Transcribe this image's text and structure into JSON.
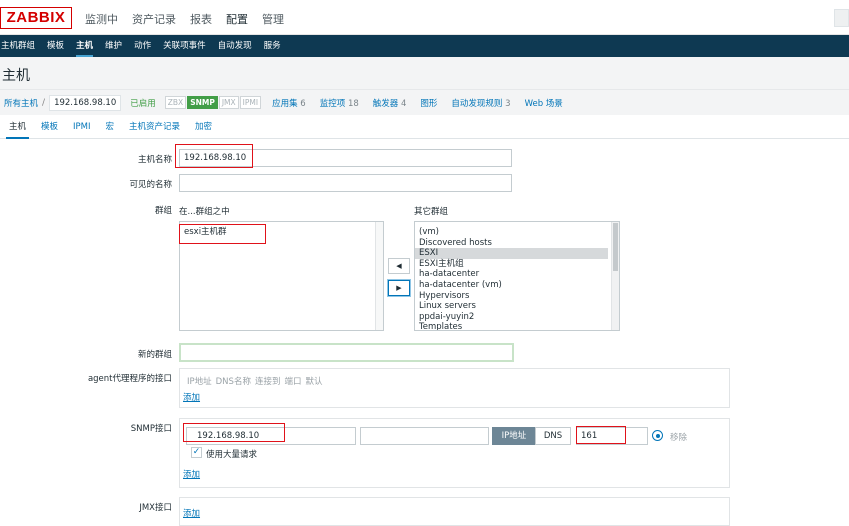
{
  "top": {
    "logo": "ZABBIX",
    "nav": [
      "监测中",
      "资产记录",
      "报表",
      "配置",
      "管理"
    ],
    "active_nav": "配置"
  },
  "subnav": [
    "主机群组",
    "模板",
    "主机",
    "维护",
    "动作",
    "关联项事件",
    "自动发现",
    "服务"
  ],
  "page_title": "主机",
  "breadcrumb": {
    "all_hosts": "所有主机",
    "separator": "/",
    "host": "192.168.98.10",
    "status": "已启用",
    "interfaces": [
      {
        "label": "ZBX",
        "on": false
      },
      {
        "label": "SNMP",
        "on": true
      },
      {
        "label": "JMX",
        "on": false
      },
      {
        "label": "IPMI",
        "on": false
      }
    ],
    "links": [
      {
        "label": "应用集",
        "count": "6"
      },
      {
        "label": "监控项",
        "count": "18"
      },
      {
        "label": "触发器",
        "count": "4"
      },
      {
        "label": "图形",
        "count": ""
      },
      {
        "label": "自动发现规则",
        "count": "3"
      },
      {
        "label": "Web 场景",
        "count": ""
      }
    ]
  },
  "tabs": [
    "主机",
    "模板",
    "IPMI",
    "宏",
    "主机资产记录",
    "加密"
  ],
  "form": {
    "host_name_label": "主机名称",
    "host_name_value": "192.168.98.10",
    "visible_name_label": "可见的名称",
    "visible_name_value": "",
    "groups_label": "群组",
    "in_groups_label": "在...群组之中",
    "in_groups": [
      "esxi主机群"
    ],
    "other_groups_label": "其它群组",
    "other_groups": [
      "(vm)",
      "Discovered hosts",
      "ESXI",
      "ESXI主机组",
      "ha-datacenter",
      "ha-datacenter (vm)",
      "Hypervisors",
      "Linux servers",
      "ppdai-yuyin2",
      "Templates"
    ],
    "other_groups_selected": "ESXI",
    "btn_left": "◀",
    "btn_right": "▶",
    "new_group_label": "新的群组",
    "new_group_value": "",
    "agent_label": "agent代理程序的接口",
    "agent_headers": [
      "IP地址",
      "DNS名称",
      "连接到",
      "端口",
      "默认"
    ],
    "agent_add": "添加",
    "snmp_label": "SNMP接口",
    "snmp_ip": "192.168.98.10",
    "snmp_dns": "",
    "snmp_connect_ip": "IP地址",
    "snmp_connect_dns": "DNS",
    "snmp_port": "161",
    "snmp_remove": "移除",
    "snmp_bulk_label": "使用大量请求",
    "snmp_bulk_check": "✓",
    "snmp_add": "添加",
    "jmx_label": "JMX接口",
    "jmx_add": "添加"
  }
}
